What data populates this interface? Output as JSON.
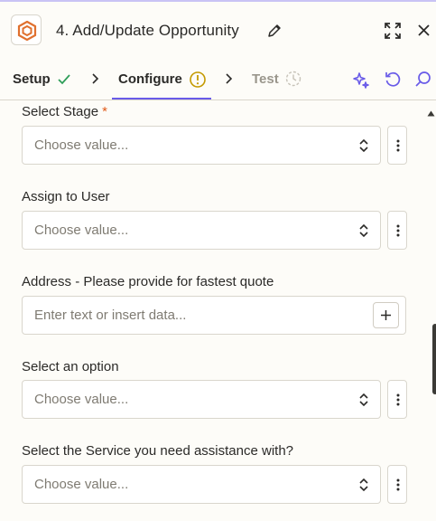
{
  "header": {
    "title": "4. Add/Update Opportunity",
    "icons": {
      "logo": "app-logo",
      "edit": "pencil-icon",
      "expand": "expand-icon",
      "close": "close-icon"
    }
  },
  "tabs": [
    {
      "label": "Setup",
      "status": "complete"
    },
    {
      "label": "Configure",
      "status": "warning",
      "active": true
    },
    {
      "label": "Test",
      "status": "pending"
    }
  ],
  "toolbar_icons": [
    "ai-sparkle-icon",
    "refresh-icon",
    "search-icon"
  ],
  "fields": [
    {
      "label": "Select Stage",
      "required": true,
      "required_mark": "*",
      "type": "select",
      "placeholder": "Choose value..."
    },
    {
      "label": "Assign to User",
      "required": false,
      "type": "select",
      "placeholder": "Choose value..."
    },
    {
      "label": "Address - Please provide for fastest quote",
      "required": false,
      "type": "text",
      "placeholder": "Enter text or insert data..."
    },
    {
      "label": "Select an option",
      "required": false,
      "type": "select",
      "placeholder": "Choose value..."
    },
    {
      "label": "Select the Service you need assistance with?",
      "required": false,
      "type": "select",
      "placeholder": "Choose value..."
    }
  ],
  "colors": {
    "accent": "#695be8",
    "required": "#e15a1a",
    "success": "#2f9e59",
    "warning": "#c49a00",
    "brand": "#e0702e"
  }
}
